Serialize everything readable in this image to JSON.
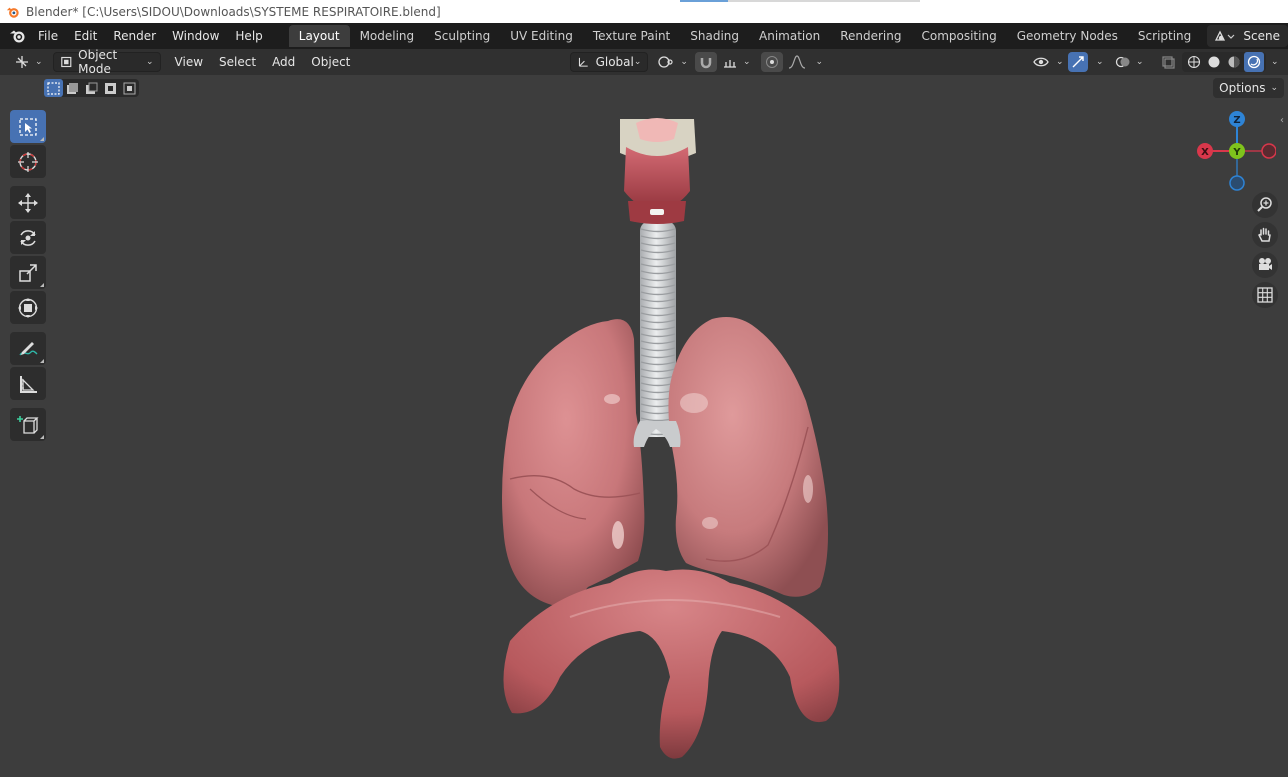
{
  "window": {
    "title": "Blender* [C:\\Users\\SIDOU\\Downloads\\SYSTEME RESPIRATOIRE.blend]"
  },
  "menu": {
    "items": [
      "File",
      "Edit",
      "Render",
      "Window",
      "Help"
    ]
  },
  "workspaces": {
    "tabs": [
      "Layout",
      "Modeling",
      "Sculpting",
      "UV Editing",
      "Texture Paint",
      "Shading",
      "Animation",
      "Rendering",
      "Compositing",
      "Geometry Nodes",
      "Scripting"
    ],
    "active": "Layout",
    "add_symbol": "+"
  },
  "scene": {
    "label": "Scene"
  },
  "header": {
    "mode": "Object Mode",
    "view": "View",
    "select": "Select",
    "add": "Add",
    "object": "Object",
    "orientation": "Global"
  },
  "tool_settings": {
    "options_label": "Options"
  },
  "gizmo": {
    "z": "Z",
    "y": "Y",
    "x": "X"
  },
  "colors": {
    "accent": "#4772b3",
    "axis_x": "#d9374b",
    "axis_y": "#7fc31c",
    "axis_z": "#2e84d6",
    "lung": "#c9777a",
    "diaphragm": "#c46a6d",
    "trachea": "#d4d6d8"
  },
  "icons": {
    "tools": [
      "select-box-icon",
      "cursor-icon",
      "move-icon",
      "rotate-icon",
      "scale-icon",
      "transform-icon",
      "annotate-icon",
      "measure-icon",
      "add-cube-icon"
    ],
    "nav": [
      "zoom-icon",
      "pan-hand-icon",
      "camera-icon",
      "grid-ortho-icon"
    ]
  }
}
